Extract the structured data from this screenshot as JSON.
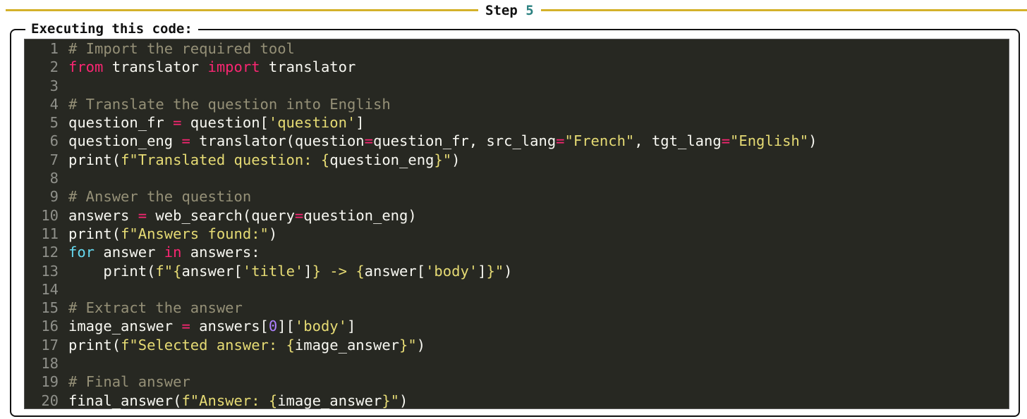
{
  "step": {
    "label": "Step",
    "number": "5"
  },
  "panel": {
    "title": "Executing this code:"
  },
  "colors": {
    "rule": "#d4b12a",
    "step_number": "#2a8080",
    "code_background": "#272822",
    "comment": "#959077",
    "keyword": "#f92672",
    "string": "#e6db74",
    "builtin_keyword": "#66d9ef",
    "number": "#ae81ff",
    "text": "#f8f8f2"
  },
  "code": {
    "language": "python",
    "lines": [
      {
        "n": "1",
        "tokens": [
          {
            "t": "comment",
            "v": "# Import the required tool"
          }
        ]
      },
      {
        "n": "2",
        "tokens": [
          {
            "t": "kw",
            "v": "from"
          },
          {
            "t": "plain",
            "v": " translator "
          },
          {
            "t": "kw",
            "v": "import"
          },
          {
            "t": "plain",
            "v": " translator"
          }
        ]
      },
      {
        "n": "3",
        "tokens": []
      },
      {
        "n": "4",
        "tokens": [
          {
            "t": "comment",
            "v": "# Translate the question into English"
          }
        ]
      },
      {
        "n": "5",
        "tokens": [
          {
            "t": "plain",
            "v": "question_fr "
          },
          {
            "t": "op",
            "v": "="
          },
          {
            "t": "plain",
            "v": " question["
          },
          {
            "t": "str",
            "v": "'question'"
          },
          {
            "t": "plain",
            "v": "]"
          }
        ]
      },
      {
        "n": "6",
        "tokens": [
          {
            "t": "plain",
            "v": "question_eng "
          },
          {
            "t": "op",
            "v": "="
          },
          {
            "t": "plain",
            "v": " translator(question"
          },
          {
            "t": "op",
            "v": "="
          },
          {
            "t": "plain",
            "v": "question_fr, src_lang"
          },
          {
            "t": "op",
            "v": "="
          },
          {
            "t": "str",
            "v": "\"French\""
          },
          {
            "t": "plain",
            "v": ", tgt_lang"
          },
          {
            "t": "op",
            "v": "="
          },
          {
            "t": "str",
            "v": "\"English\""
          },
          {
            "t": "plain",
            "v": ")"
          }
        ]
      },
      {
        "n": "7",
        "tokens": [
          {
            "t": "plain",
            "v": "print("
          },
          {
            "t": "str",
            "v": "f\"Translated question: {"
          },
          {
            "t": "plain",
            "v": "question_eng"
          },
          {
            "t": "str",
            "v": "}\""
          },
          {
            "t": "plain",
            "v": ")"
          }
        ]
      },
      {
        "n": "8",
        "tokens": []
      },
      {
        "n": "9",
        "tokens": [
          {
            "t": "comment",
            "v": "# Answer the question"
          }
        ]
      },
      {
        "n": "10",
        "tokens": [
          {
            "t": "plain",
            "v": "answers "
          },
          {
            "t": "op",
            "v": "="
          },
          {
            "t": "plain",
            "v": " web_search(query"
          },
          {
            "t": "op",
            "v": "="
          },
          {
            "t": "plain",
            "v": "question_eng)"
          }
        ]
      },
      {
        "n": "11",
        "tokens": [
          {
            "t": "plain",
            "v": "print("
          },
          {
            "t": "str",
            "v": "f\"Answers found:\""
          },
          {
            "t": "plain",
            "v": ")"
          }
        ]
      },
      {
        "n": "12",
        "tokens": [
          {
            "t": "for",
            "v": "for"
          },
          {
            "t": "plain",
            "v": " answer "
          },
          {
            "t": "kw",
            "v": "in"
          },
          {
            "t": "plain",
            "v": " answers:"
          }
        ]
      },
      {
        "n": "13",
        "tokens": [
          {
            "t": "plain",
            "v": "    print("
          },
          {
            "t": "str",
            "v": "f\"{"
          },
          {
            "t": "plain",
            "v": "answer["
          },
          {
            "t": "str",
            "v": "'title'"
          },
          {
            "t": "plain",
            "v": "]"
          },
          {
            "t": "str",
            "v": "} -> {"
          },
          {
            "t": "plain",
            "v": "answer["
          },
          {
            "t": "str",
            "v": "'body'"
          },
          {
            "t": "plain",
            "v": "]"
          },
          {
            "t": "str",
            "v": "}\""
          },
          {
            "t": "plain",
            "v": ")"
          }
        ]
      },
      {
        "n": "14",
        "tokens": []
      },
      {
        "n": "15",
        "tokens": [
          {
            "t": "comment",
            "v": "# Extract the answer"
          }
        ]
      },
      {
        "n": "16",
        "tokens": [
          {
            "t": "plain",
            "v": "image_answer "
          },
          {
            "t": "op",
            "v": "="
          },
          {
            "t": "plain",
            "v": " answers["
          },
          {
            "t": "num",
            "v": "0"
          },
          {
            "t": "plain",
            "v": "]["
          },
          {
            "t": "str",
            "v": "'body'"
          },
          {
            "t": "plain",
            "v": "]"
          }
        ]
      },
      {
        "n": "17",
        "tokens": [
          {
            "t": "plain",
            "v": "print("
          },
          {
            "t": "str",
            "v": "f\"Selected answer: {"
          },
          {
            "t": "plain",
            "v": "image_answer"
          },
          {
            "t": "str",
            "v": "}\""
          },
          {
            "t": "plain",
            "v": ")"
          }
        ]
      },
      {
        "n": "18",
        "tokens": []
      },
      {
        "n": "19",
        "tokens": [
          {
            "t": "comment",
            "v": "# Final answer"
          }
        ]
      },
      {
        "n": "20",
        "tokens": [
          {
            "t": "plain",
            "v": "final_answer("
          },
          {
            "t": "str",
            "v": "f\"Answer: {"
          },
          {
            "t": "plain",
            "v": "image_answer"
          },
          {
            "t": "str",
            "v": "}\""
          },
          {
            "t": "plain",
            "v": ")"
          }
        ]
      }
    ]
  }
}
